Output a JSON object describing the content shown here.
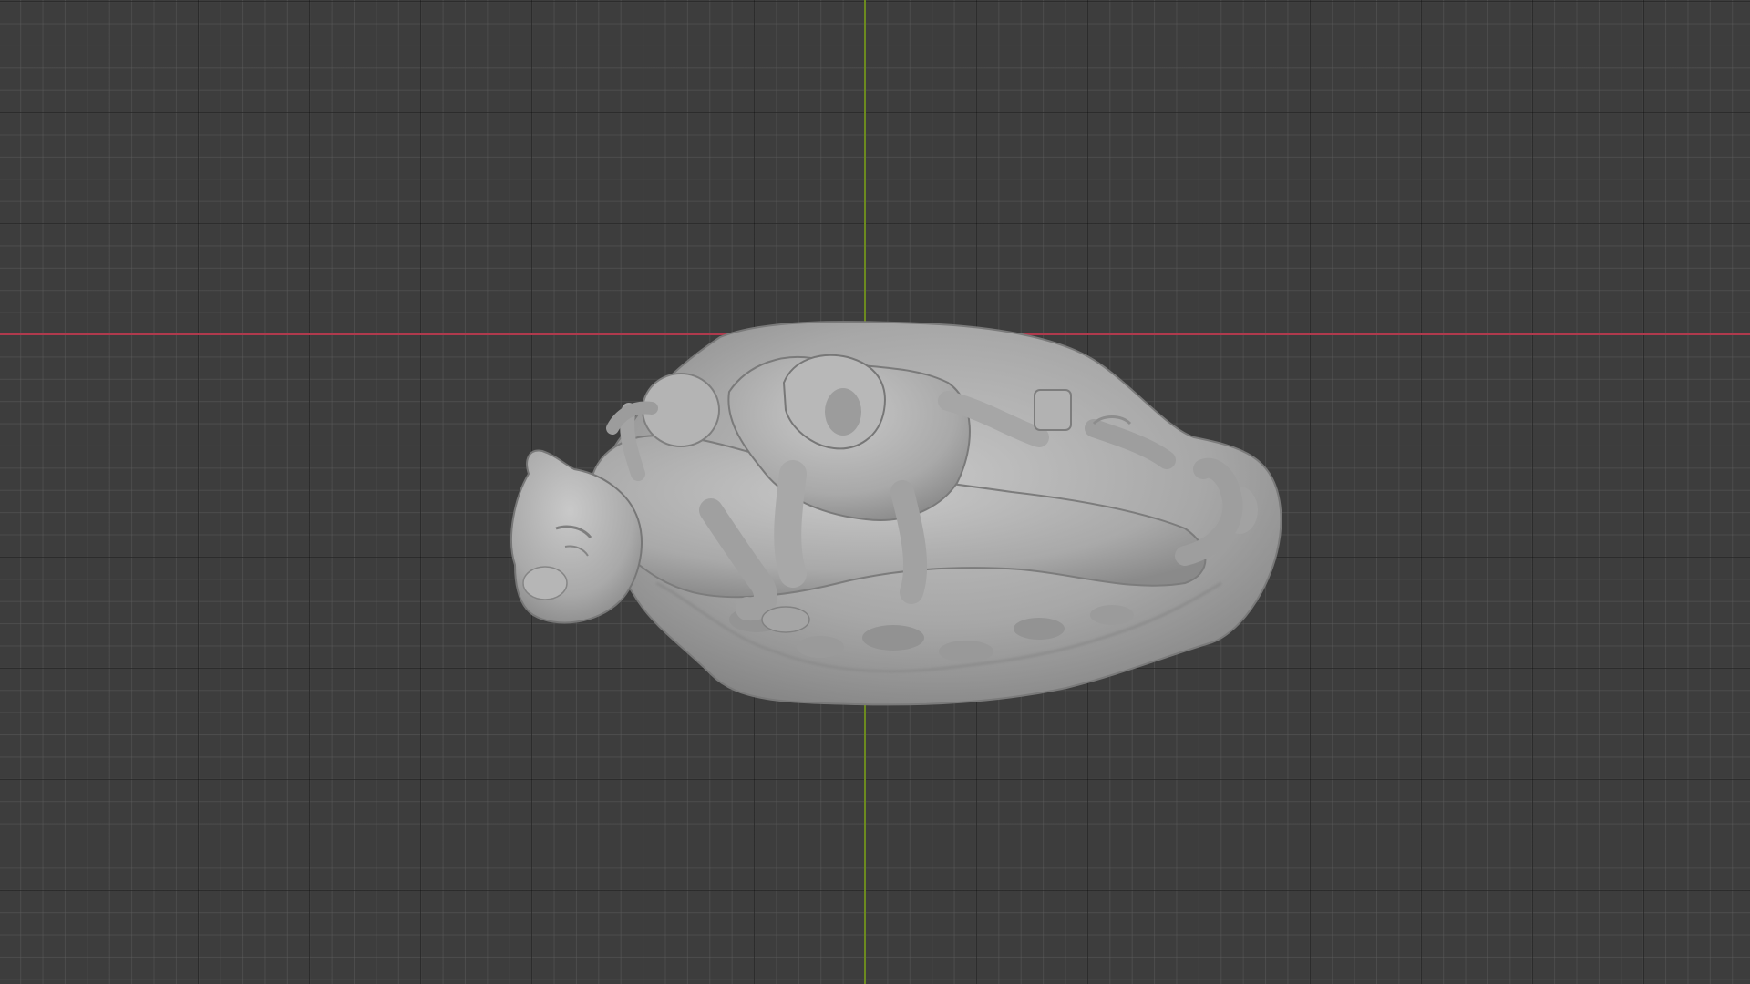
{
  "viewport": {
    "background_color": "#3d3d3d",
    "grid_minor_color": "#5f5f5f",
    "grid_major_color": "#141414"
  },
  "axes": {
    "x_axis_color": "#b03a4d",
    "y_axis_color": "#6c8a1f"
  },
  "model": {
    "description_icon": "sculpted-puma-mesh",
    "material_color": "#a8a8a8",
    "shadow_color": "#6e6e6e",
    "highlight_color": "#c6c6c6"
  }
}
